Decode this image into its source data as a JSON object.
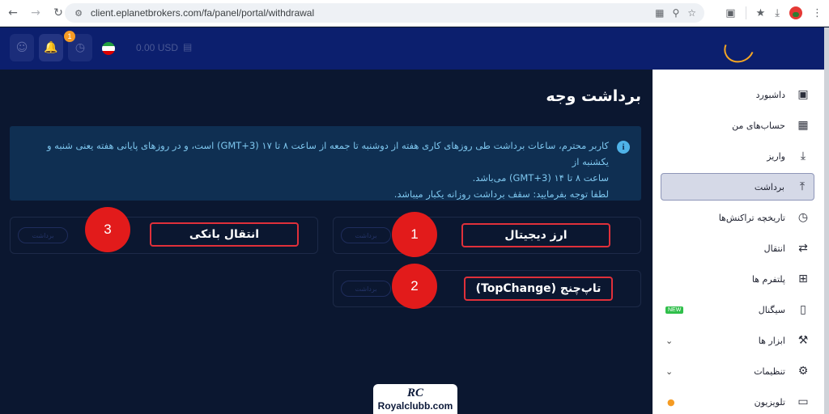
{
  "browser": {
    "url": "client.eplanetbrokers.com/fa/panel/portal/withdrawal"
  },
  "header": {
    "notification_count": "1",
    "balance": "0.00 USD"
  },
  "sidebar": {
    "items": [
      {
        "label": "داشبورد",
        "icon": "dashboard-icon"
      },
      {
        "label": "حساب‌های من",
        "icon": "accounts-grid-icon"
      },
      {
        "label": "واریز",
        "icon": "download-icon"
      },
      {
        "label": "برداشت",
        "icon": "upload-icon",
        "active": true
      },
      {
        "label": "تاریخچه تراکنش‌ها",
        "icon": "history-icon"
      },
      {
        "label": "انتقال",
        "icon": "transfer-icon"
      },
      {
        "label": "پلتفرم ها",
        "icon": "platform-icon"
      },
      {
        "label": "سیگنال",
        "icon": "signal-icon",
        "badge": "NEW"
      },
      {
        "label": "ابزار ها",
        "icon": "tools-icon",
        "expandable": true
      },
      {
        "label": "تنظیمات",
        "icon": "settings-icon",
        "expandable": true
      },
      {
        "label": "تلویزیون",
        "icon": "tv-icon"
      }
    ]
  },
  "main": {
    "title": "برداشت وجه",
    "info_line1": "کاربر محترم، ساعات برداشت طی روزهای کاری هفته از دوشنبه تا جمعه از ساعت ۸ تا ۱۷ (GMT+3) است، و در روزهای پایانی هفته یعنی شنبه و یکشنبه از",
    "info_line2": "ساعت ۸ تا ۱۴ (GMT+3) می‌باشد.",
    "info_line3": "لطفا توجه بفرمایید: سقف برداشت روزانه یکبار میباشد.",
    "methods": [
      {
        "name": "ارز دیجیتال",
        "step": "1",
        "button": "برداشت"
      },
      {
        "name": "تاپ‌چنج (TopChange)",
        "step": "2",
        "button": "برداشت"
      },
      {
        "name": "انتقال بانکی",
        "step": "3",
        "button": "برداشت"
      }
    ]
  },
  "watermark": {
    "logo": "RC",
    "text": "Royalclubb.com"
  }
}
